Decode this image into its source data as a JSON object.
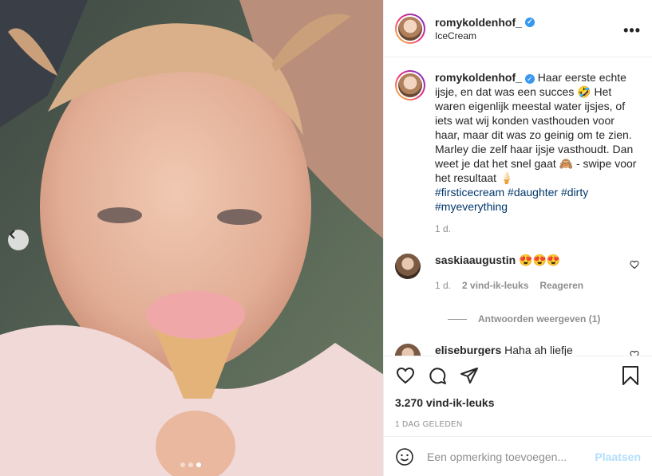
{
  "post": {
    "username": "romykoldenhof_",
    "location": "IceCream",
    "more_icon": "more-horizontal-icon",
    "caption": {
      "username": "romykoldenhof_",
      "text": "Haar eerste echte ijsje, en dat was een succes 🤣 Het waren eigenlijk meestal water ijsjes, of iets wat wij konden vasthouden voor haar, maar dit was zo geinig om te zien. Marley die zelf haar ijsje vasthoudt. Dan weet je dat het snel gaat 🙈 - swipe voor het resultaat 🍦",
      "hashtags": [
        "#firsticecream",
        "#daughter",
        "#dirty",
        "#myeverything"
      ],
      "time": "1 d."
    },
    "comments": [
      {
        "username": "saskiaaugustin",
        "text": "😍😍😍",
        "time": "1 d.",
        "likes": "2 vind-ik-leuks",
        "reply_label": "Reageren",
        "view_replies": "Antwoorden weergeven (1)"
      },
      {
        "username": "eliseburgers",
        "text": "Haha ah liefje"
      }
    ],
    "like_count": "3.270 vind-ik-leuks",
    "date": "1 DAG GELEDEN",
    "comment_placeholder": "Een opmerking toevoegen...",
    "post_button": "Plaatsen",
    "carousel": {
      "slides": 3,
      "active_index": 2
    }
  }
}
